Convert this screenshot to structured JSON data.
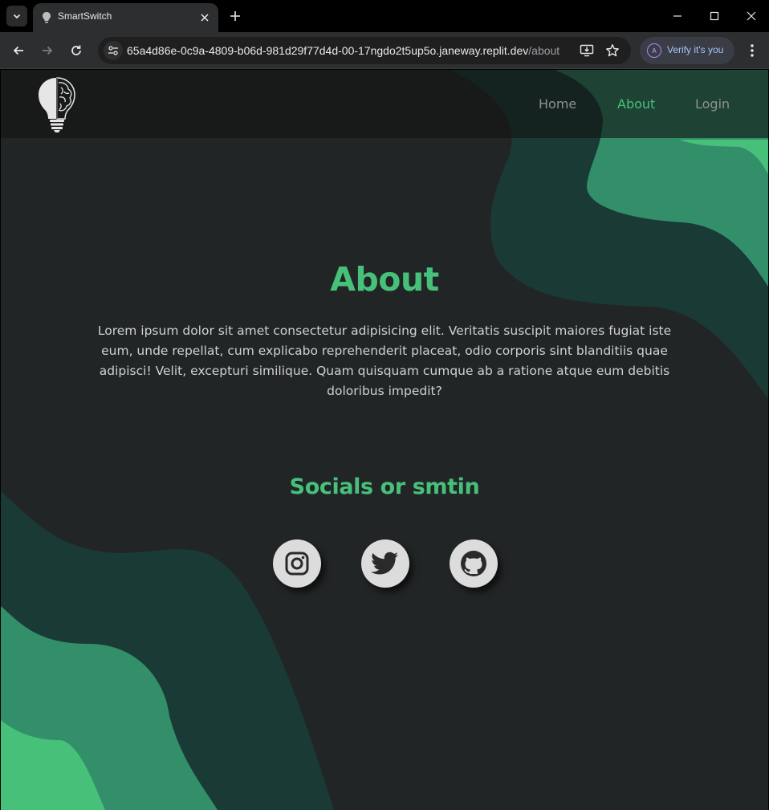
{
  "browser": {
    "tab_title": "SmartSwitch",
    "url_host": "65a4d86e-0c9a-4809-b06d-981d29f77d4d-00-17ngdo2t5up5o.janeway.replit.dev",
    "url_path": "/about",
    "verify_label": "Verify it's you",
    "avatar_letter": "A"
  },
  "nav": {
    "links": [
      {
        "label": "Home",
        "active": false
      },
      {
        "label": "About",
        "active": true
      },
      {
        "label": "Login",
        "active": false
      }
    ]
  },
  "about": {
    "title": "About",
    "body": "Lorem ipsum dolor sit amet consectetur adipisicing elit. Veritatis suscipit maiores fugiat iste eum, unde repellat, cum explicabo reprehenderit placeat, odio corporis sint blanditiis quae adipisci! Velit, excepturi similique. Quam quisquam cumque ab a ratione atque eum debitis doloribus impedit?"
  },
  "socials": {
    "title": "Socials or smtin",
    "icons": [
      "instagram-icon",
      "twitter-icon",
      "github-icon"
    ]
  },
  "colors": {
    "accent": "#47c07a",
    "background": "#222526",
    "wave_dark": "#1a3a35",
    "wave_mid": "#338f6a",
    "wave_light": "#47c07a"
  }
}
